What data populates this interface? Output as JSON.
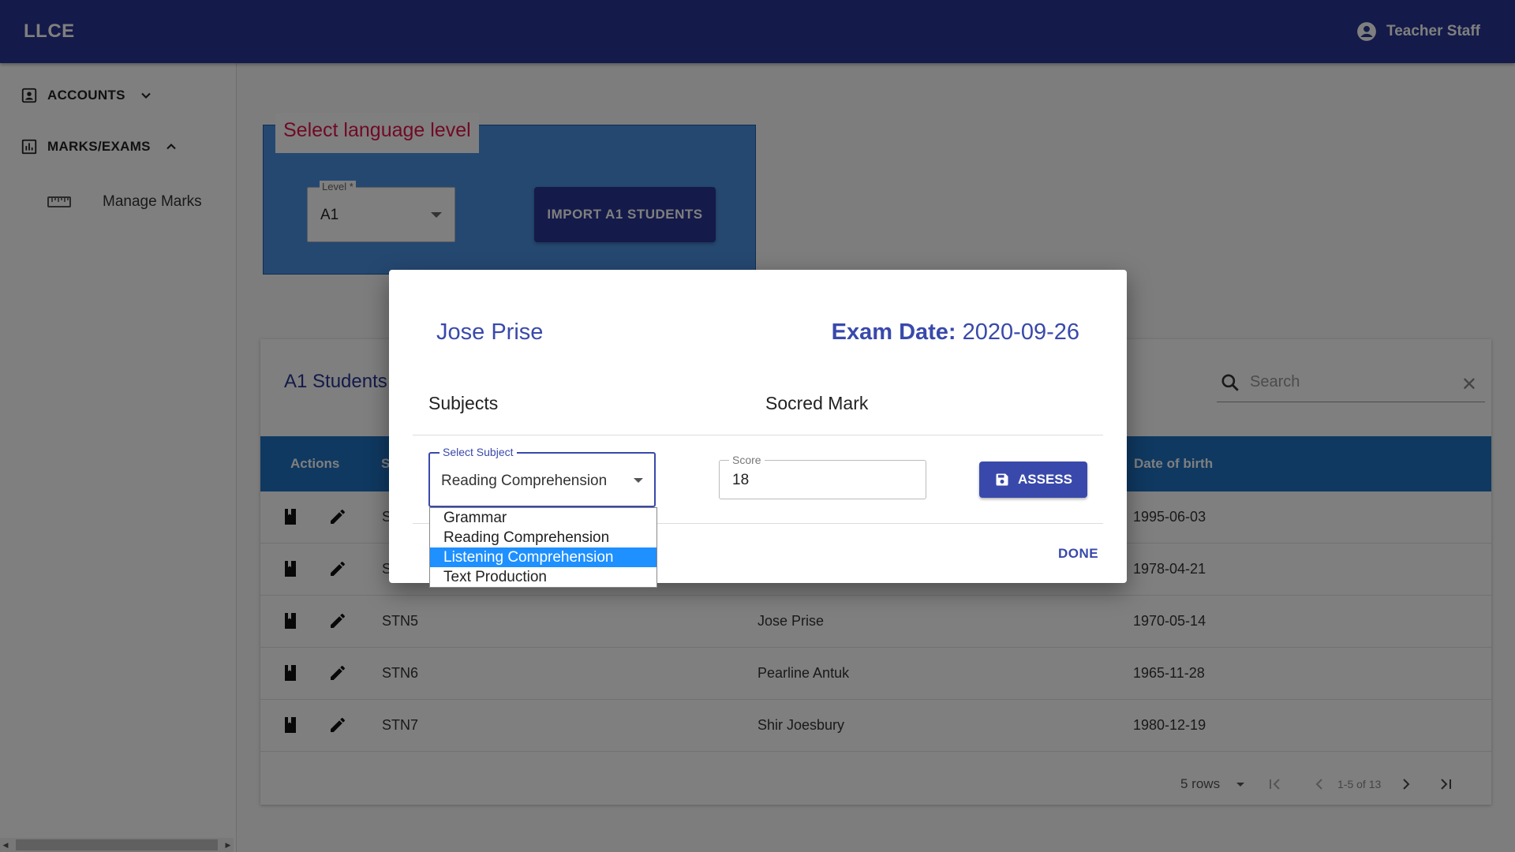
{
  "app": {
    "brand": "LLCE",
    "user": "Teacher Staff"
  },
  "sidebar": {
    "accounts": "ACCOUNTS",
    "marks": "MARKS/EXAMS",
    "manage": "Manage Marks"
  },
  "level": {
    "title": "Select language level",
    "label": "Level *",
    "value": "A1",
    "import": "IMPORT A1 STUDENTS"
  },
  "table": {
    "title": "A1 Students",
    "search_placeholder": "Search",
    "headers": {
      "actions": "Actions",
      "code": "S",
      "dob": "Date of birth"
    },
    "rows": [
      {
        "code": "S",
        "name": "",
        "dob": "1995-06-03"
      },
      {
        "code": "S",
        "name": "",
        "dob": "1978-04-21"
      },
      {
        "code": "STN5",
        "name": "Jose Prise",
        "dob": "1970-05-14"
      },
      {
        "code": "STN6",
        "name": "Pearline Antuk",
        "dob": "1965-11-28"
      },
      {
        "code": "STN7",
        "name": "Shir Joesbury",
        "dob": "1980-12-19"
      }
    ],
    "pager": {
      "rows": "5 rows",
      "range": "1-5 of 13"
    }
  },
  "dialog": {
    "student": "Jose Prise",
    "date_label": "Exam Date:",
    "date_value": "2020-09-26",
    "col_subjects": "Subjects",
    "col_mark": "Socred Mark",
    "select_label": "Select Subject",
    "select_value": "Reading Comprehension",
    "score_label": "Score",
    "score_value": "18",
    "assess": "ASSESS",
    "done": "DONE",
    "options": [
      "Grammar",
      "Reading Comprehension",
      "Listening Comprehension",
      "Text Production"
    ],
    "highlighted_option": "Listening Comprehension"
  },
  "colors": {
    "appbar": "#283593",
    "accent": "#3949ab",
    "table_header": "#1e72c2",
    "level_title": "#e0144c"
  }
}
